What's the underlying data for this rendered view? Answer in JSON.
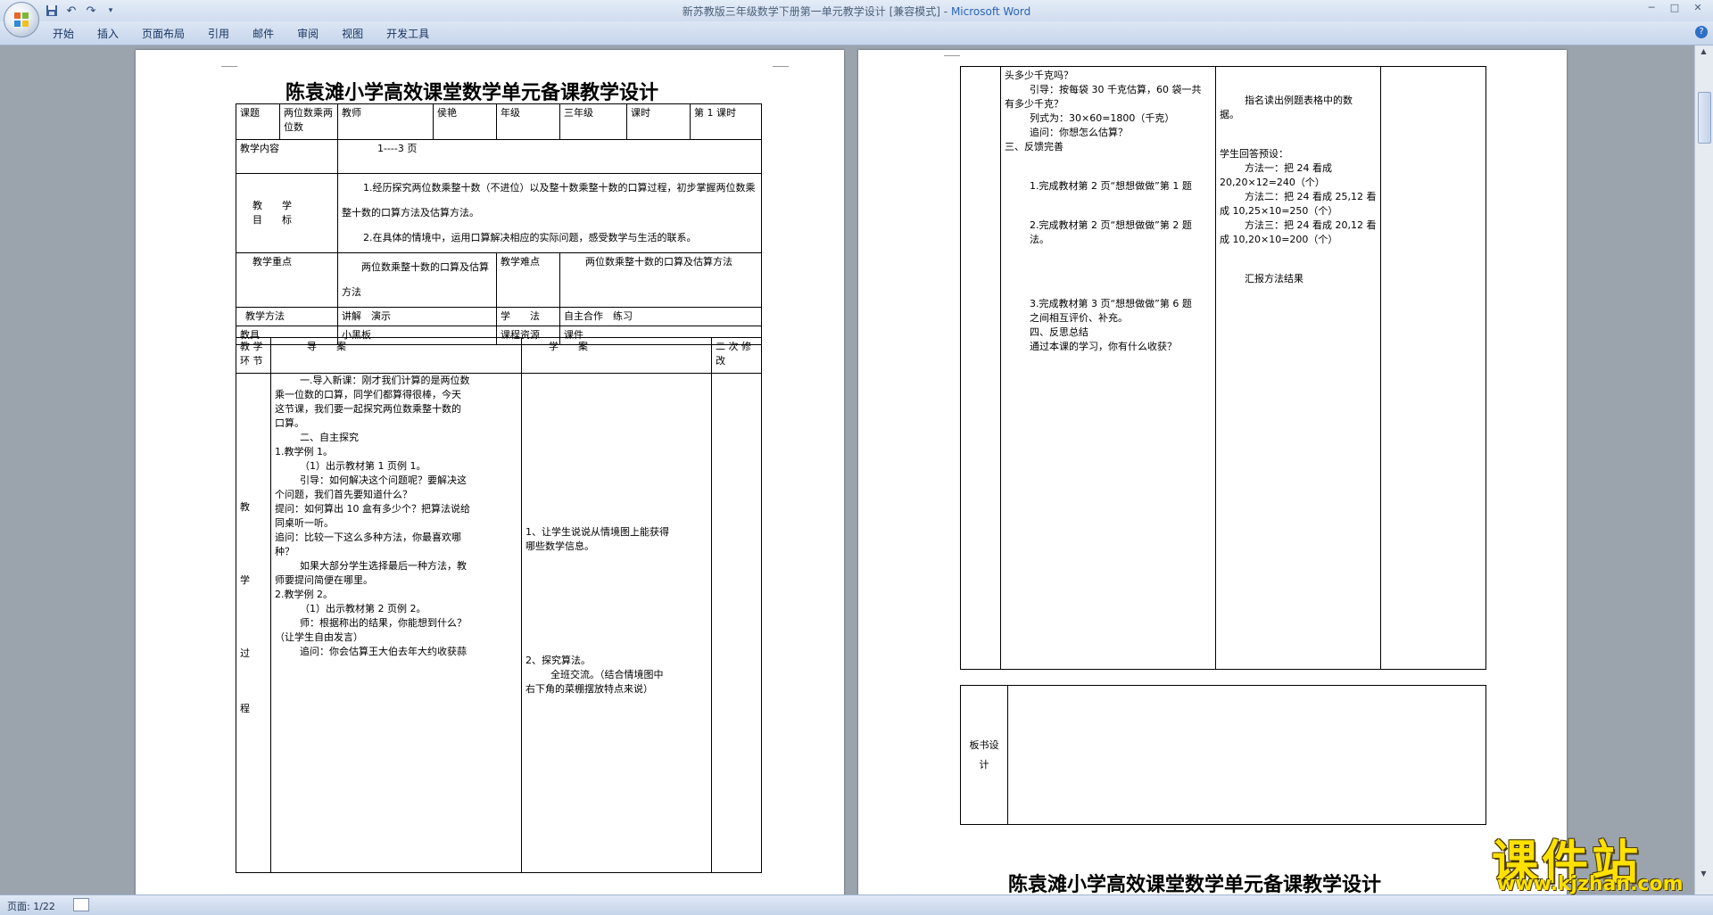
{
  "window": {
    "title_doc": "新苏教版三年级数学下册第一单元教学设计 [兼容模式]",
    "title_sep": " - ",
    "title_app": "Microsoft Word",
    "min": "─",
    "max": "□",
    "close": "✕"
  },
  "qat": {
    "save_icon": "save-icon",
    "undo": "↶",
    "redo": "↷",
    "more": "▾"
  },
  "ribbon": {
    "tabs": [
      "开始",
      "插入",
      "页面布局",
      "引用",
      "邮件",
      "审阅",
      "视图",
      "开发工具"
    ],
    "help": "?"
  },
  "status": {
    "page": "页面: 1/22"
  },
  "watermark": {
    "text": "课件站",
    "url": "www.kjzhan.com"
  },
  "page1": {
    "title": "陈袁滩小学高效课堂数学单元备课教学设计",
    "hdr": {
      "course_label": "课题",
      "course_value": "两位数乘两位数",
      "teacher_label": "教师",
      "teacher_value": "侯艳",
      "grade_label": "年级",
      "grade_value": "三年级",
      "period_label": "课时",
      "period_value": "第 1 课时"
    },
    "content_label": "教学内容",
    "content_value": "1----3 页",
    "goal_label_1": "教　　学",
    "goal_label_2": "目　　标",
    "goal_1": "1.经历探究两位数乘整十数（不进位）以及整十数乘整十数的口算过程，初步掌握两位数乘整十数的口算方法及估算方法。",
    "goal_2": "2.在具体的情境中，运用口算解决相应的实际问题，感受数学与生活的联系。",
    "key_label": "教学重点",
    "key_value": "两位数乘整十数的口算及估算方法",
    "diff_label": "教学难点",
    "diff_value": "两位数乘整十数的口算及估算方法",
    "method_label": "教学方法",
    "method_value": "讲解　演示",
    "learn_label": "学　　法",
    "learn_value": "自主合作　练习",
    "tool_label": "教具",
    "tool_value": "小黑板",
    "res_label": "课程资源",
    "res_value": "课件",
    "col_stage": "教 学 环 节",
    "col_guide": "导　　案",
    "col_study": "学　　案",
    "col_revise": "二 次 修 改",
    "stage_chars": [
      "教",
      "学",
      "过",
      "程"
    ],
    "guide_lines": [
      "一.导入新课：刚才我们计算的是两位数",
      "乘一位数的口算，同学们都算得很棒，今天",
      "这节课，我们要一起探究两位数乘整十数的",
      "口算。",
      "二、自主探究",
      "1.教学例 1。",
      "（1）出示教材第 1 页例 1。",
      "引导：如何解决这个问题呢？要解决这",
      "个问题，我们首先要知道什么？",
      "提问：如何算出 10 盒有多少个？把算法说给",
      "同桌听一听。",
      "追问：比较一下这么多种方法，你最喜欢哪",
      "种？",
      "如果大部分学生选择最后一种方法，教",
      "师要提问简便在哪里。",
      "2.教学例 2。",
      "（1）出示教材第 2 页例 2。",
      "师：根据称出的结果，你能想到什么？",
      "（让学生自由发言）",
      "追问：你会估算王大伯去年大约收获蒜"
    ],
    "study_lines": [
      "1、让学生说说从情境图上能获得",
      "哪些数学信息。",
      "2、探究算法。",
      "全班交流。（结合情境图中",
      "右下角的菜棚摆放特点来说）"
    ]
  },
  "page2": {
    "guide_lines": [
      "头多少千克吗？",
      "引导：按每袋 30 千克估算，60 袋一共",
      "有多少千克？",
      "列式为：30×60=1800（千克）",
      "追问：你想怎么估算？",
      "三、反馈完善",
      "1.完成教材第 2 页“想想做做”第 1 题",
      "2.完成教材第 2 页“想想做做”第 2 题",
      "法。",
      "3.完成教材第 3 页“想想做做”第 6 题",
      "之间相互评价、补充。",
      "四、反思总结",
      "通过本课的学习，你有什么收获？"
    ],
    "study_lines": [
      "指名读出例题表格中的数",
      "据。",
      "学生回答预设：",
      "方法一：把 24 看成",
      "20,20×12=240（个）",
      "方法二：把 24 看成 25,12 看",
      "成 10,25×10=250（个）",
      "方法三：把 24 看成 20,12 看",
      "成 10,20×10=200（个）",
      "汇报方法结果"
    ],
    "board_label": "板书设计",
    "title": "陈袁滩小学高效课堂数学单元备课教学设计"
  },
  "colors": {
    "accent": "#2a64b8",
    "watermark": "#ffe100"
  }
}
